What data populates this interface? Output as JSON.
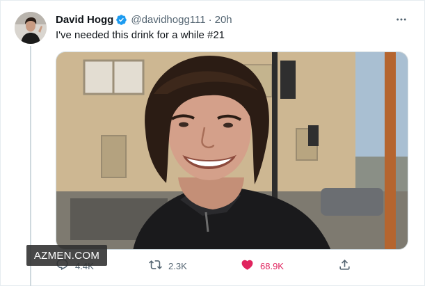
{
  "tweet": {
    "author_name": "David Hogg",
    "handle": "@davidhogg111",
    "separator": "·",
    "time": "20h",
    "text": "I've needed this drink for a while #21"
  },
  "actions": {
    "reply_count": "4.4K",
    "retweet_count": "2.3K",
    "like_count": "68.9K"
  },
  "watermark": "AZMEN.COM",
  "colors": {
    "verified": "#1d9bf0",
    "like": "#e0245e",
    "muted_text": "#536471"
  },
  "icons": [
    "verified-badge-icon",
    "more-options-icon",
    "reply-icon",
    "retweet-icon",
    "heart-icon",
    "share-icon"
  ]
}
